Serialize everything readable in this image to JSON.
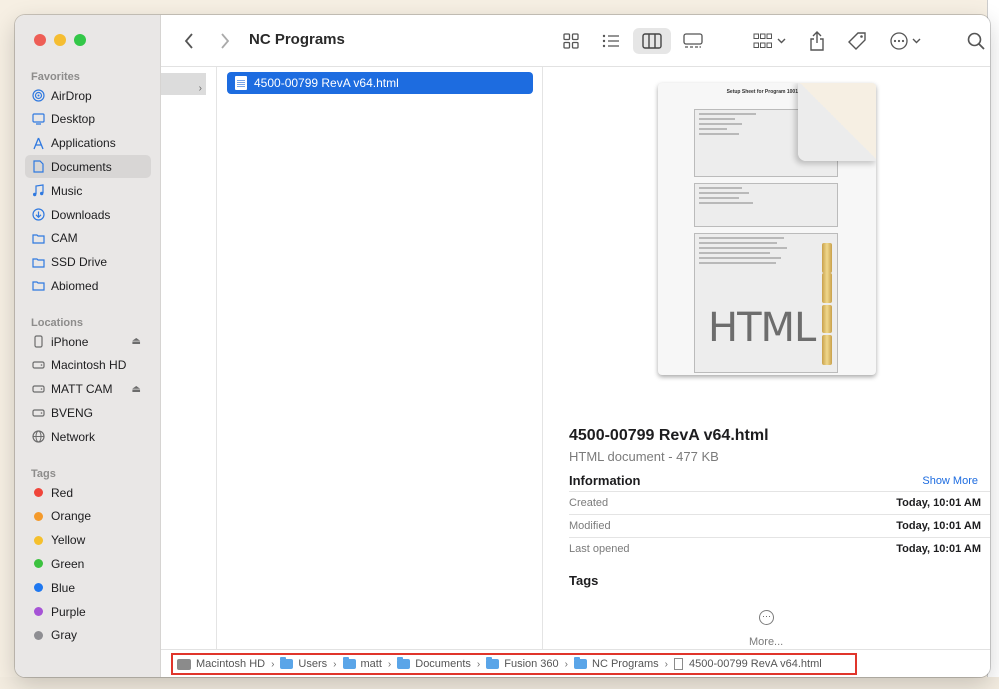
{
  "window": {
    "title": "NC Programs"
  },
  "sidebar": {
    "favorites_title": "Favorites",
    "favorites": [
      {
        "label": "AirDrop",
        "icon": "airdrop-icon"
      },
      {
        "label": "Desktop",
        "icon": "desktop-icon"
      },
      {
        "label": "Applications",
        "icon": "applications-icon"
      },
      {
        "label": "Documents",
        "icon": "document-icon",
        "selected": true
      },
      {
        "label": "Music",
        "icon": "music-icon"
      },
      {
        "label": "Downloads",
        "icon": "download-icon"
      },
      {
        "label": "CAM",
        "icon": "folder-icon"
      },
      {
        "label": "SSD Drive",
        "icon": "folder-icon"
      },
      {
        "label": "Abiomed",
        "icon": "folder-icon"
      }
    ],
    "locations_title": "Locations",
    "locations": [
      {
        "label": "iPhone",
        "icon": "iphone-icon",
        "eject": true
      },
      {
        "label": "Macintosh HD",
        "icon": "drive-icon"
      },
      {
        "label": "MATT CAM",
        "icon": "drive-icon",
        "eject": true
      },
      {
        "label": "BVENG",
        "icon": "drive-icon"
      },
      {
        "label": "Network",
        "icon": "network-icon"
      }
    ],
    "tags_title": "Tags",
    "tags": [
      {
        "label": "Red",
        "color": "#f0453a"
      },
      {
        "label": "Orange",
        "color": "#f49a2b"
      },
      {
        "label": "Yellow",
        "color": "#f5c02c"
      },
      {
        "label": "Green",
        "color": "#3cc23f"
      },
      {
        "label": "Blue",
        "color": "#1f78f0"
      },
      {
        "label": "Purple",
        "color": "#a653d6"
      },
      {
        "label": "Gray",
        "color": "#8e8e92"
      }
    ]
  },
  "column": {
    "selected_file": "4500-00799 RevA v64.html"
  },
  "preview": {
    "thumbnail_title": "Setup Sheet for Program 1001",
    "thumbnail_label": "HTML",
    "name": "4500-00799 RevA v64.html",
    "kind": "HTML document - 477 KB",
    "info_title": "Information",
    "show_more": "Show More",
    "info": [
      {
        "key": "Created",
        "value": "Today, 10:01 AM"
      },
      {
        "key": "Modified",
        "value": "Today, 10:01 AM"
      },
      {
        "key": "Last opened",
        "value": "Today, 10:01 AM"
      }
    ],
    "tags_title": "Tags",
    "more_label": "More..."
  },
  "pathbar": {
    "crumbs": [
      {
        "label": "Macintosh HD",
        "type": "drive"
      },
      {
        "label": "Users",
        "type": "folder"
      },
      {
        "label": "matt",
        "type": "folder"
      },
      {
        "label": "Documents",
        "type": "folder"
      },
      {
        "label": "Fusion 360",
        "type": "folder"
      },
      {
        "label": "NC Programs",
        "type": "folder"
      },
      {
        "label": "4500-00799 RevA v64.html",
        "type": "file"
      }
    ]
  }
}
